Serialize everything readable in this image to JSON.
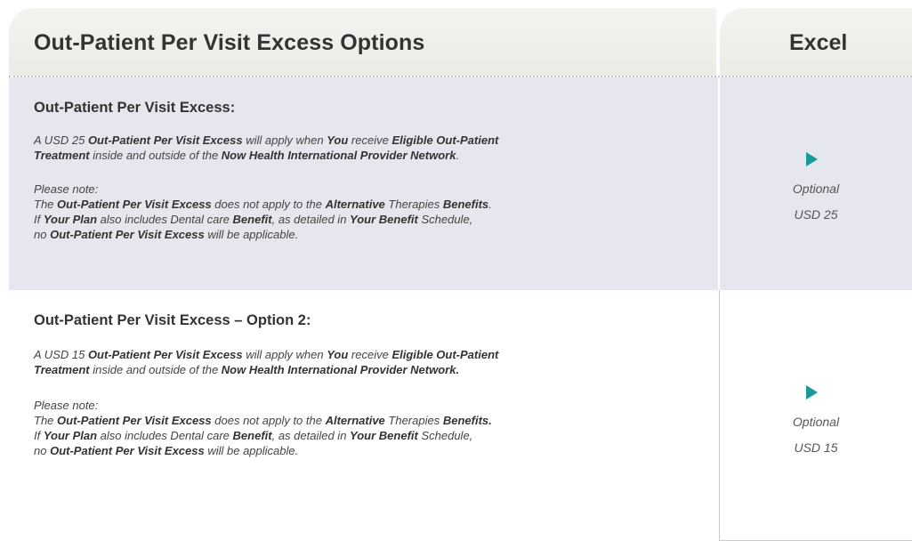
{
  "header": {
    "title": "Out-Patient Per Visit Excess Options",
    "column": "Excel"
  },
  "sections": [
    {
      "title": "Out-Patient Per Visit Excess:",
      "intro": [
        [
          "A USD 25 ",
          ""
        ],
        [
          "Out-Patient Per Visit Excess",
          "b"
        ],
        [
          " will apply when ",
          ""
        ],
        [
          "You",
          "b"
        ],
        [
          " receive ",
          ""
        ],
        [
          "Eligible Out-Patient",
          "b"
        ]
      ],
      "intro2": [
        [
          "Treatment",
          "b"
        ],
        [
          " inside and outside of the ",
          ""
        ],
        [
          "Now Health International Provider Network",
          "b"
        ],
        [
          ".",
          ""
        ]
      ],
      "note_label": "Please note:",
      "note1": [
        [
          "The ",
          ""
        ],
        [
          "Out-Patient Per Visit Excess",
          "b"
        ],
        [
          " does not apply to the ",
          ""
        ],
        [
          "Alternative",
          "b"
        ],
        [
          " Therapies ",
          ""
        ],
        [
          "Benefits",
          "b"
        ],
        [
          ".",
          ""
        ]
      ],
      "note2": [
        [
          "If ",
          ""
        ],
        [
          "Your Plan",
          "b"
        ],
        [
          " also includes Dental care ",
          ""
        ],
        [
          "Benefit",
          "b"
        ],
        [
          ", as detailed in ",
          ""
        ],
        [
          "Your Benefit",
          "b"
        ],
        [
          " Schedule,",
          ""
        ]
      ],
      "note3": [
        [
          "no ",
          ""
        ],
        [
          "Out-Patient Per Visit Excess",
          "b"
        ],
        [
          " will be applicable.",
          ""
        ]
      ],
      "option_label": "Optional",
      "option_value": "USD 25"
    },
    {
      "title": "Out-Patient Per Visit Excess – Option 2:",
      "intro": [
        [
          "A USD 15 ",
          ""
        ],
        [
          "Out-Patient Per Visit Excess",
          "b"
        ],
        [
          " will apply when ",
          ""
        ],
        [
          "You",
          "b"
        ],
        [
          " receive ",
          ""
        ],
        [
          "Eligible Out-Patient",
          "b"
        ]
      ],
      "intro2": [
        [
          "Treatment",
          "b"
        ],
        [
          " inside and outside of the ",
          ""
        ],
        [
          "Now Health International Provider Network.",
          "b"
        ]
      ],
      "note_label": "Please note:",
      "note1": [
        [
          "The ",
          ""
        ],
        [
          "Out-Patient Per Visit Excess",
          "b"
        ],
        [
          " does not apply to the ",
          ""
        ],
        [
          "Alternative",
          "b"
        ],
        [
          " Therapies ",
          ""
        ],
        [
          "Benefits.",
          "b"
        ]
      ],
      "note2": [
        [
          "If ",
          ""
        ],
        [
          "Your Plan",
          "b"
        ],
        [
          " also includes Dental care ",
          ""
        ],
        [
          "Benefit",
          "b"
        ],
        [
          ", as detailed in ",
          ""
        ],
        [
          "Your Benefit",
          "b"
        ],
        [
          " Schedule,",
          ""
        ]
      ],
      "note3": [
        [
          "no ",
          ""
        ],
        [
          "Out-Patient Per Visit Excess",
          "b"
        ],
        [
          " will be applicable.",
          ""
        ]
      ],
      "option_label": "Optional",
      "option_value": "USD 15"
    }
  ],
  "colors": {
    "accent_triangle": "#169a9a",
    "row_shade": "#e5e6ee",
    "header_bg": "#efeeea"
  },
  "icons": {
    "option_marker": "play-triangle-icon"
  }
}
